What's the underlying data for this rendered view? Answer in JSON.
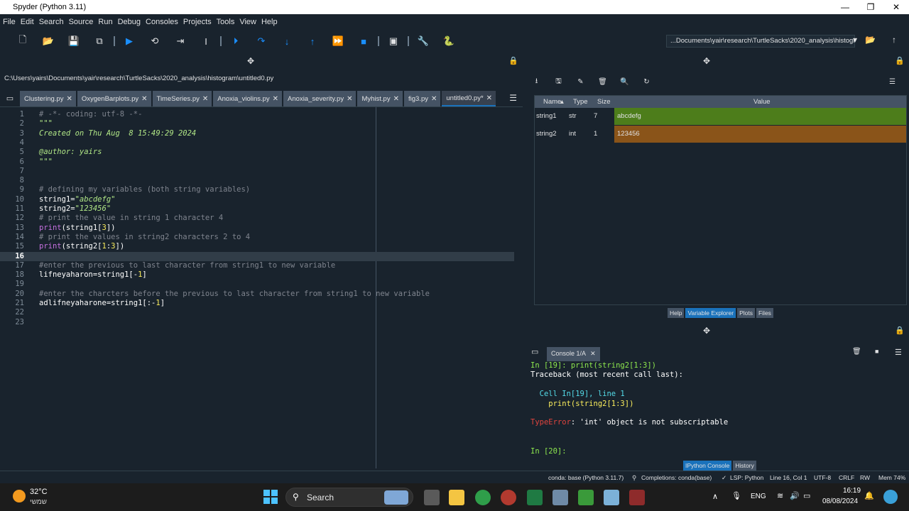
{
  "window": {
    "title": "Spyder (Python 3.11)",
    "controls": [
      "—",
      "❐",
      "✕"
    ]
  },
  "menu": [
    "File",
    "Edit",
    "Search",
    "Source",
    "Run",
    "Debug",
    "Consoles",
    "Projects",
    "Tools",
    "View",
    "Help"
  ],
  "toolbar": {
    "working_dir": "...Documents\\yair\\research\\TurtleSacks\\2020_analysis\\histogram"
  },
  "editor": {
    "file_path": "C:\\Users\\yairs\\Documents\\yair\\research\\TurtleSacks\\2020_analysis\\histogram\\untitled0.py",
    "tabs": [
      {
        "label": "Clustering.py"
      },
      {
        "label": "OxygenBarplots.py"
      },
      {
        "label": "TimeSeries.py"
      },
      {
        "label": "Anoxia_violins.py"
      },
      {
        "label": "Anoxia_severity.py"
      },
      {
        "label": "Myhist.py"
      },
      {
        "label": "fig3.py"
      },
      {
        "label": "untitled0.py*",
        "active": true
      }
    ],
    "current_line": 16,
    "lines": [
      "# -*- coding: utf-8 -*-",
      "\"\"\"",
      "Created on Thu Aug  8 15:49:29 2024",
      "",
      "@author: yairs",
      "\"\"\"",
      "",
      "",
      "# defining my variables (both string variables)",
      "string1=\"abcdefg\"",
      "string2=\"123456\"",
      "# print the value in string 1 character 4",
      "print(string1[3])",
      "# print the values in string2 characters 2 to 4",
      "print(string2[1:3])",
      "",
      "#enter the previous to last character from string1 to new variable",
      "lifneyaharon=string1[-1]",
      "",
      "#enter the charcters before the previous to last character from string1 to new variable",
      "adlifneyaharone=string1[:-1]",
      "",
      ""
    ]
  },
  "variable_explorer": {
    "headers": {
      "name": "Name",
      "type": "Type",
      "size": "Size",
      "value": "Value"
    },
    "rows": [
      {
        "name": "string1",
        "type": "str",
        "size": "7",
        "value": "abcdefg",
        "color": "#4d7d1b"
      },
      {
        "name": "string2",
        "type": "int",
        "size": "1",
        "value": "123456",
        "color": "#8a5419"
      }
    ],
    "pane_tabs": [
      "Help",
      "Variable Explorer",
      "Plots",
      "Files"
    ],
    "active_pane_tab": "Variable Explorer"
  },
  "console": {
    "tab_label": "Console 1/A",
    "lines": [
      {
        "text": "In [19]: print(string2[1:3])",
        "color": "#8ee84e"
      },
      {
        "text": "Traceback (most recent call last):",
        "color": "#ffffff"
      },
      {
        "text": "",
        "color": "#ffffff"
      },
      {
        "text": "  Cell In[19], line 1",
        "color": "#54dbe8"
      },
      {
        "text": "    print(string2[1:3])",
        "color": "#faed5c"
      },
      {
        "text": "",
        "color": "#ffffff"
      },
      {
        "text": "TypeError: 'int' object is not subscriptable",
        "color": "#ffffff"
      },
      {
        "text": "",
        "color": "#ffffff"
      },
      {
        "text": "",
        "color": "#ffffff"
      },
      {
        "text": "In [20]:",
        "color": "#8ee84e"
      }
    ],
    "pane_tabs": [
      "IPython Console",
      "History"
    ],
    "active_pane_tab": "IPython Console"
  },
  "statusbar": {
    "env": "conda: base (Python 3.11.7)",
    "completions": "Completions: conda(base)",
    "lsp": "LSP: Python",
    "position": "Line 16, Col 1",
    "encoding": "UTF-8",
    "eol": "CRLF",
    "mode": "RW",
    "mem": "Mem 74%"
  },
  "taskbar": {
    "weather_temp": "32°C",
    "weather_desc": "שמשי",
    "search_label": "Search",
    "language": "ENG",
    "time": "16:19",
    "date": "08/08/2024"
  }
}
